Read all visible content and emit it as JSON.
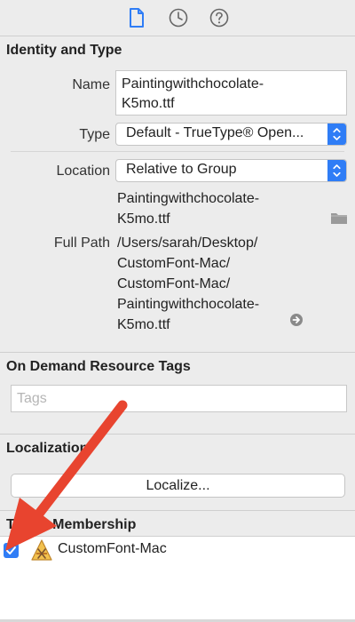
{
  "toolbar": {
    "tabs": [
      {
        "icon": "file-inspector-icon",
        "active": true
      },
      {
        "icon": "history-clock-icon",
        "active": false
      },
      {
        "icon": "quick-help-icon",
        "active": false
      }
    ]
  },
  "identity": {
    "header": "Identity and Type",
    "name_label": "Name",
    "name_value_line1": "Paintingwithchocolate-",
    "name_value_line2": "K5mo.ttf",
    "type_label": "Type",
    "type_value": "Default - TrueType® Open...",
    "location_label": "Location",
    "location_value": "Relative to Group",
    "file_line1": "Paintingwithchocolate-",
    "file_line2": "K5mo.ttf",
    "fullpath_label": "Full Path",
    "fullpath_lines": [
      "/Users/sarah/Desktop/",
      "CustomFont-Mac/",
      "CustomFont-Mac/",
      "Paintingwithchocolate-",
      "K5mo.ttf"
    ]
  },
  "on_demand": {
    "header": "On Demand Resource Tags",
    "tags_placeholder": "Tags"
  },
  "localization": {
    "header": "Localization",
    "button_label": "Localize..."
  },
  "target_membership": {
    "header": "Target Membership",
    "targets": [
      {
        "name": "CustomFont-Mac",
        "checked": true,
        "icon": "app-target-icon"
      }
    ]
  },
  "colors": {
    "accent": "#2f7df6",
    "annotation_arrow": "#e8442f",
    "panel_background": "#ececec"
  }
}
